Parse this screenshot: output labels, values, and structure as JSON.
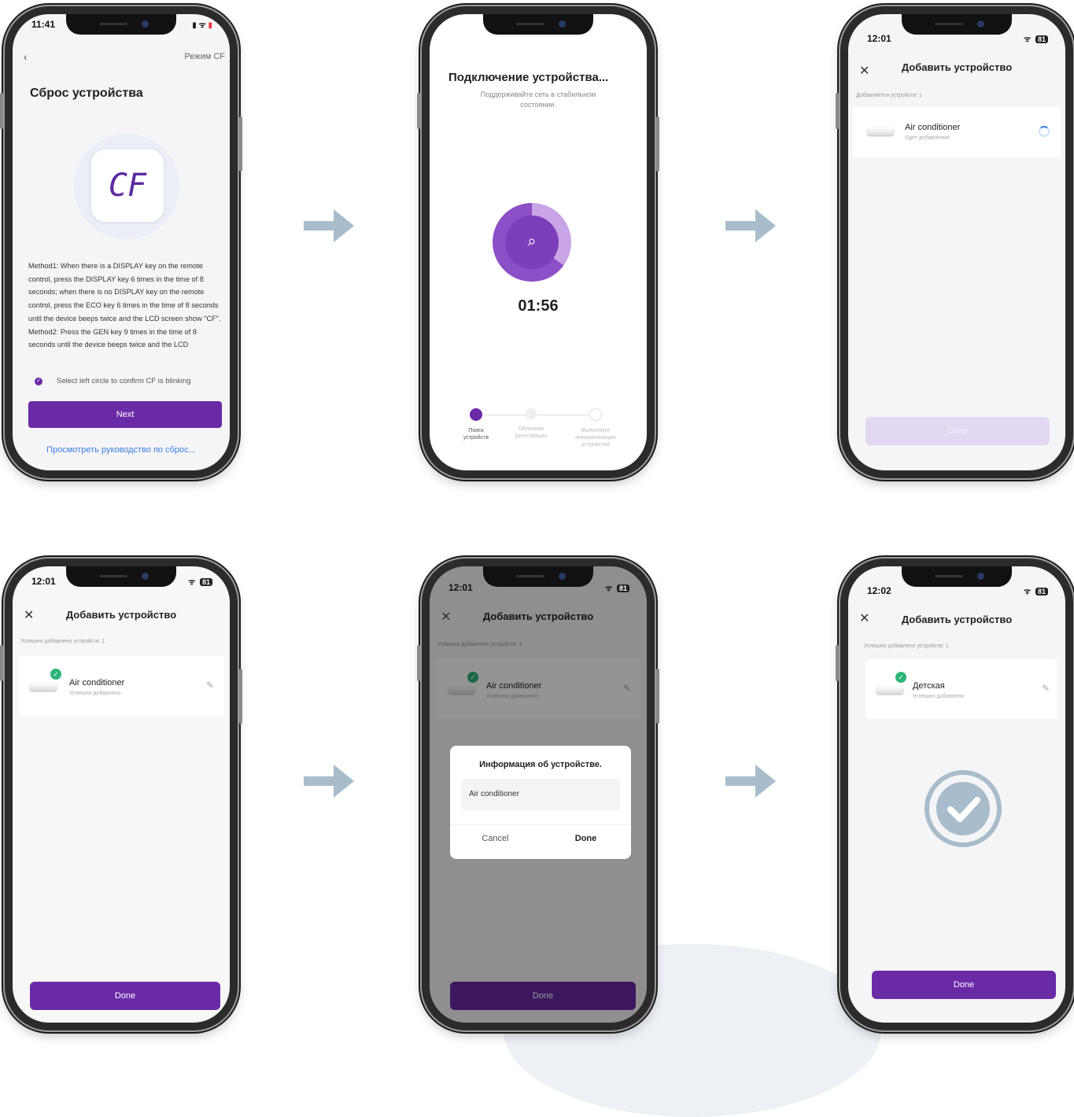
{
  "screen1": {
    "time": "11:41",
    "mode": "Режим CF",
    "title": "Сброс устройства",
    "cf": "CF",
    "instructions": "Method1: When there is a DISPLAY key on the remote control, press the DISPLAY key 6 times in the time of 8 seconds; when there is no DISPLAY key on the remote control, press the ECO key 6 times in the time of 8 seconds until the device beeps twice and the LCD screen show \"CF\". Method2: Press the GEN key 9 times in the time of 8 seconds until the device beeps twice and the LCD",
    "confirm": "Select left circle to confirm CF is blinking",
    "next": "Next",
    "guide": "Просмотреть руководство по сброс..."
  },
  "screen2": {
    "title": "Подключение устройства...",
    "subtitle": "Поддерживайте сеть в стабильном состоянии.",
    "timer": "01:56",
    "steps": [
      {
        "label": "Поиск устройств",
        "active": true
      },
      {
        "label": "Облачная регистрация",
        "active": false
      },
      {
        "label": "Выполните инициализацию устройства",
        "active": false
      }
    ]
  },
  "screen3": {
    "time": "12:01",
    "battery": "81",
    "title": "Добавить устройство",
    "adding": "Добавляется устройств: 1",
    "device": "Air conditioner",
    "status": "Идет добавление",
    "done": "Done"
  },
  "screen4": {
    "time": "12:01",
    "battery": "81",
    "title": "Добавить устройство",
    "added": "Успешно добавлено устройств: 1",
    "device": "Air conditioner",
    "status": "Успешно добавлено",
    "done": "Done"
  },
  "screen5": {
    "time": "12:01",
    "battery": "81",
    "title": "Добавить устройство",
    "added": "Успешно добавлено устройств: 1",
    "device": "Air conditioner",
    "status": "Успешно добавлено",
    "dialog_title": "Информация об устройстве.",
    "input_value": "Air conditioner",
    "cancel": "Cancel",
    "dialog_done": "Done",
    "done": "Done"
  },
  "screen6": {
    "time": "12:02",
    "battery": "81",
    "title": "Добавить устройство",
    "added": "Успешно добавлено устройств: 1",
    "device": "Детская",
    "status": "Успешно добавлено",
    "done": "Done"
  },
  "colors": {
    "accent": "#6a2aa6",
    "arrow": "#a9bccb",
    "success": "#2db37a"
  }
}
